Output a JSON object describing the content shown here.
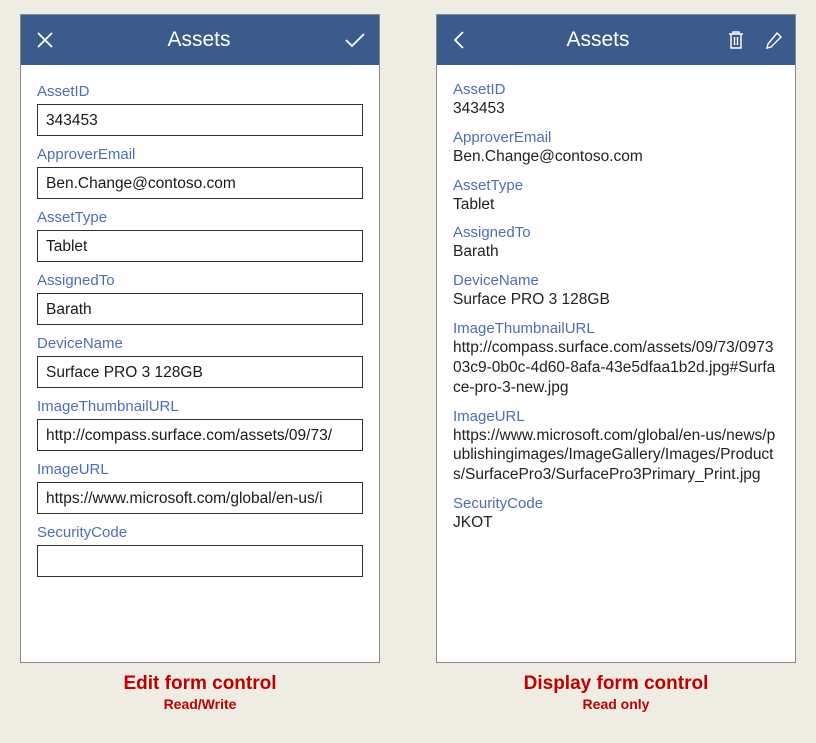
{
  "edit_screen": {
    "title": "Assets",
    "fields": {
      "asset_id": {
        "label": "AssetID",
        "value": "343453"
      },
      "approver_email": {
        "label": "ApproverEmail",
        "value": "Ben.Change@contoso.com"
      },
      "asset_type": {
        "label": "AssetType",
        "value": "Tablet"
      },
      "assigned_to": {
        "label": "AssignedTo",
        "value": "Barath"
      },
      "device_name": {
        "label": "DeviceName",
        "value": "Surface PRO 3 128GB"
      },
      "image_thumb": {
        "label": "ImageThumbnailURL",
        "value": "http://compass.surface.com/assets/09/73/"
      },
      "image_url": {
        "label": "ImageURL",
        "value": "https://www.microsoft.com/global/en-us/i"
      },
      "security_code": {
        "label": "SecurityCode",
        "value": ""
      }
    }
  },
  "display_screen": {
    "title": "Assets",
    "fields": {
      "asset_id": {
        "label": "AssetID",
        "value": "343453"
      },
      "approver_email": {
        "label": "ApproverEmail",
        "value": "Ben.Change@contoso.com"
      },
      "asset_type": {
        "label": "AssetType",
        "value": "Tablet"
      },
      "assigned_to": {
        "label": "AssignedTo",
        "value": "Barath"
      },
      "device_name": {
        "label": "DeviceName",
        "value": "Surface PRO 3 128GB"
      },
      "image_thumb": {
        "label": "ImageThumbnailURL",
        "value": "http://compass.surface.com/assets/09/73/097303c9-0b0c-4d60-8afa-43e5dfaa1b2d.jpg#Surface-pro-3-new.jpg"
      },
      "image_url": {
        "label": "ImageURL",
        "value": "https://www.microsoft.com/global/en-us/news/publishingimages/ImageGallery/Images/Products/SurfacePro3/SurfacePro3Primary_Print.jpg"
      },
      "security_code": {
        "label": "SecurityCode",
        "value": "JKOT"
      }
    }
  },
  "captions": {
    "edit": {
      "title": "Edit form control",
      "sub": "Read/Write"
    },
    "display": {
      "title": "Display form control",
      "sub": "Read only"
    }
  }
}
